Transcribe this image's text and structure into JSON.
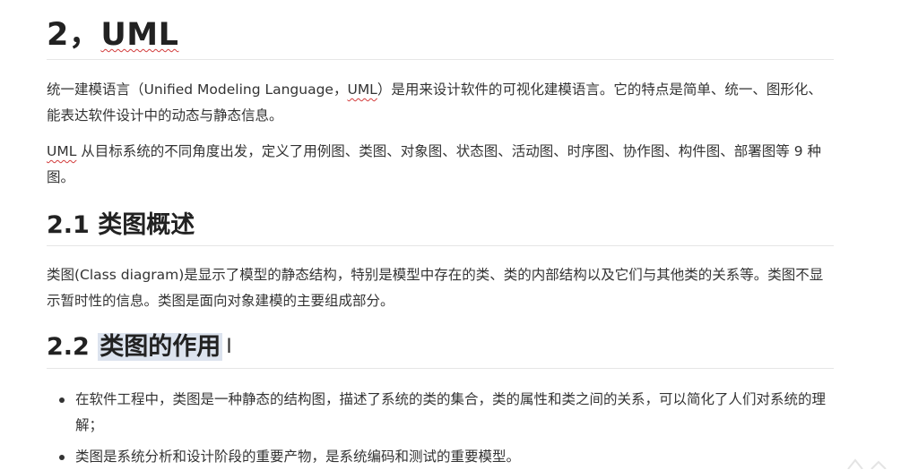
{
  "title": {
    "number": "2，",
    "word": "UML"
  },
  "intro": {
    "para1_prefix": "统一建模语言（Unified Modeling Language，",
    "para1_uml": "UML",
    "para1_suffix": "）是用来设计软件的可视化建模语言。它的特点是简单、统一、图形化、能表达软件设计中的动态与静态信息。",
    "para2_uml": "UML",
    "para2_suffix": " 从目标系统的不同角度出发，定义了用例图、类图、对象图、状态图、活动图、时序图、协作图、构件图、部署图等 9 种图。"
  },
  "section_2_1": {
    "heading": "2.1 类图概述",
    "body": "类图(Class diagram)是显示了模型的静态结构，特别是模型中存在的类、类的内部结构以及它们与其他类的关系等。类图不显示暂时性的信息。类图是面向对象建模的主要组成部分。"
  },
  "section_2_2": {
    "heading_number": "2.2 ",
    "heading_text": "类图的作用",
    "bullets": [
      "在软件工程中，类图是一种静态的结构图，描述了系统的类的集合，类的属性和类之间的关系，可以简化了人们对系统的理解；",
      "类图是系统分析和设计阶段的重要产物，是系统编码和测试的重要模型。"
    ]
  },
  "cursor_glyph": "I",
  "colors": {
    "heading_text": "#222222",
    "body_text": "#333333",
    "highlight": "#dce3ee",
    "spellcheck_underline": "#d23b3b",
    "rule": "#e6e6e6"
  }
}
